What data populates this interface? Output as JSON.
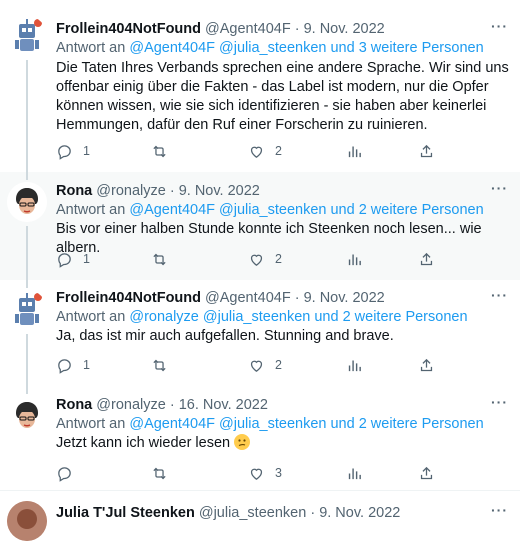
{
  "tweets": [
    {
      "name": "Frollein404NotFound",
      "handle": "@Agent404F",
      "sep": " · ",
      "date": "9. Nov. 2022",
      "reply_prefix": "Antwort an ",
      "reply_targets": "@Agent404F @julia_steenken und 3 weitere Personen",
      "text": "Die Taten Ihres Verbands sprechen eine andere Sprache. Wir sind uns offenbar einig über die Fakten - das Label ist modern, nur die Opfer können wissen, wie sie sich identifizieren - sie haben aber keinerlei Hemmungen, dafür den Ruf einer Forscherin zu ruinieren.",
      "replies": "1",
      "retweets": "",
      "likes": "2",
      "more": "···"
    },
    {
      "name": "Rona",
      "handle": "@ronalyze",
      "sep": " · ",
      "date": "9. Nov. 2022",
      "reply_prefix": "Antwort an ",
      "reply_targets": "@Agent404F @julia_steenken und 2 weitere Personen",
      "text": "Bis vor einer halben Stunde konnte ich Steenken noch lesen... wie albern.",
      "replies": "1",
      "retweets": "",
      "likes": "2",
      "more": "···"
    },
    {
      "name": "Frollein404NotFound",
      "handle": "@Agent404F",
      "sep": " · ",
      "date": "9. Nov. 2022",
      "reply_prefix": "Antwort an ",
      "reply_targets": "@ronalyze @julia_steenken und 2 weitere Personen",
      "text": "Ja, das ist mir auch aufgefallen. Stunning and brave.",
      "replies": "1",
      "retweets": "",
      "likes": "2",
      "more": "···"
    },
    {
      "name": "Rona",
      "handle": "@ronalyze",
      "sep": " · ",
      "date": "16. Nov. 2022",
      "reply_prefix": "Antwort an ",
      "reply_targets": "@Agent404F @julia_steenken und 2 weitere Personen",
      "text": "Jetzt kann ich wieder lesen",
      "replies": "",
      "retweets": "",
      "likes": "3",
      "more": "···"
    },
    {
      "name": "Julia T'Jul Steenken",
      "handle": "@julia_steenken",
      "sep": " · ",
      "date": "9. Nov. 2022",
      "more": "···"
    }
  ]
}
